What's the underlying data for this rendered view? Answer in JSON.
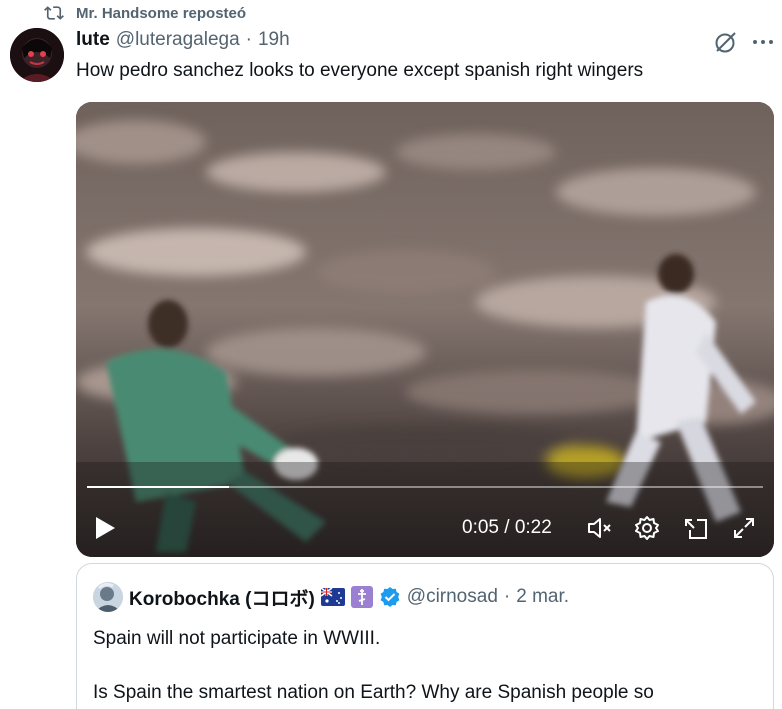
{
  "repost": {
    "icon": "repost-icon",
    "label": "Mr. Handsome reposteó"
  },
  "tweet": {
    "author_name": "lute",
    "author_handle": "@luteragalega",
    "separator": "·",
    "time": "19h",
    "text": "How pedro sanchez looks to everyone except spanish right wingers"
  },
  "video": {
    "current_time": "0:05",
    "duration": "0:22",
    "time_display": "0:05 / 0:22",
    "progress": 0.21
  },
  "quote": {
    "author_name": "Korobochka (コロボ)",
    "author_handle": "@cirnosad",
    "separator": "·",
    "date": "2 mar.",
    "line1": "Spain will not participate in WWIII.",
    "line2": "Is Spain the smartest nation on Earth? Why are Spanish people so"
  },
  "colors": {
    "text_primary": "#0f1419",
    "text_secondary": "#536471",
    "border": "#cfd9de",
    "verified": "#1d9bf0"
  }
}
